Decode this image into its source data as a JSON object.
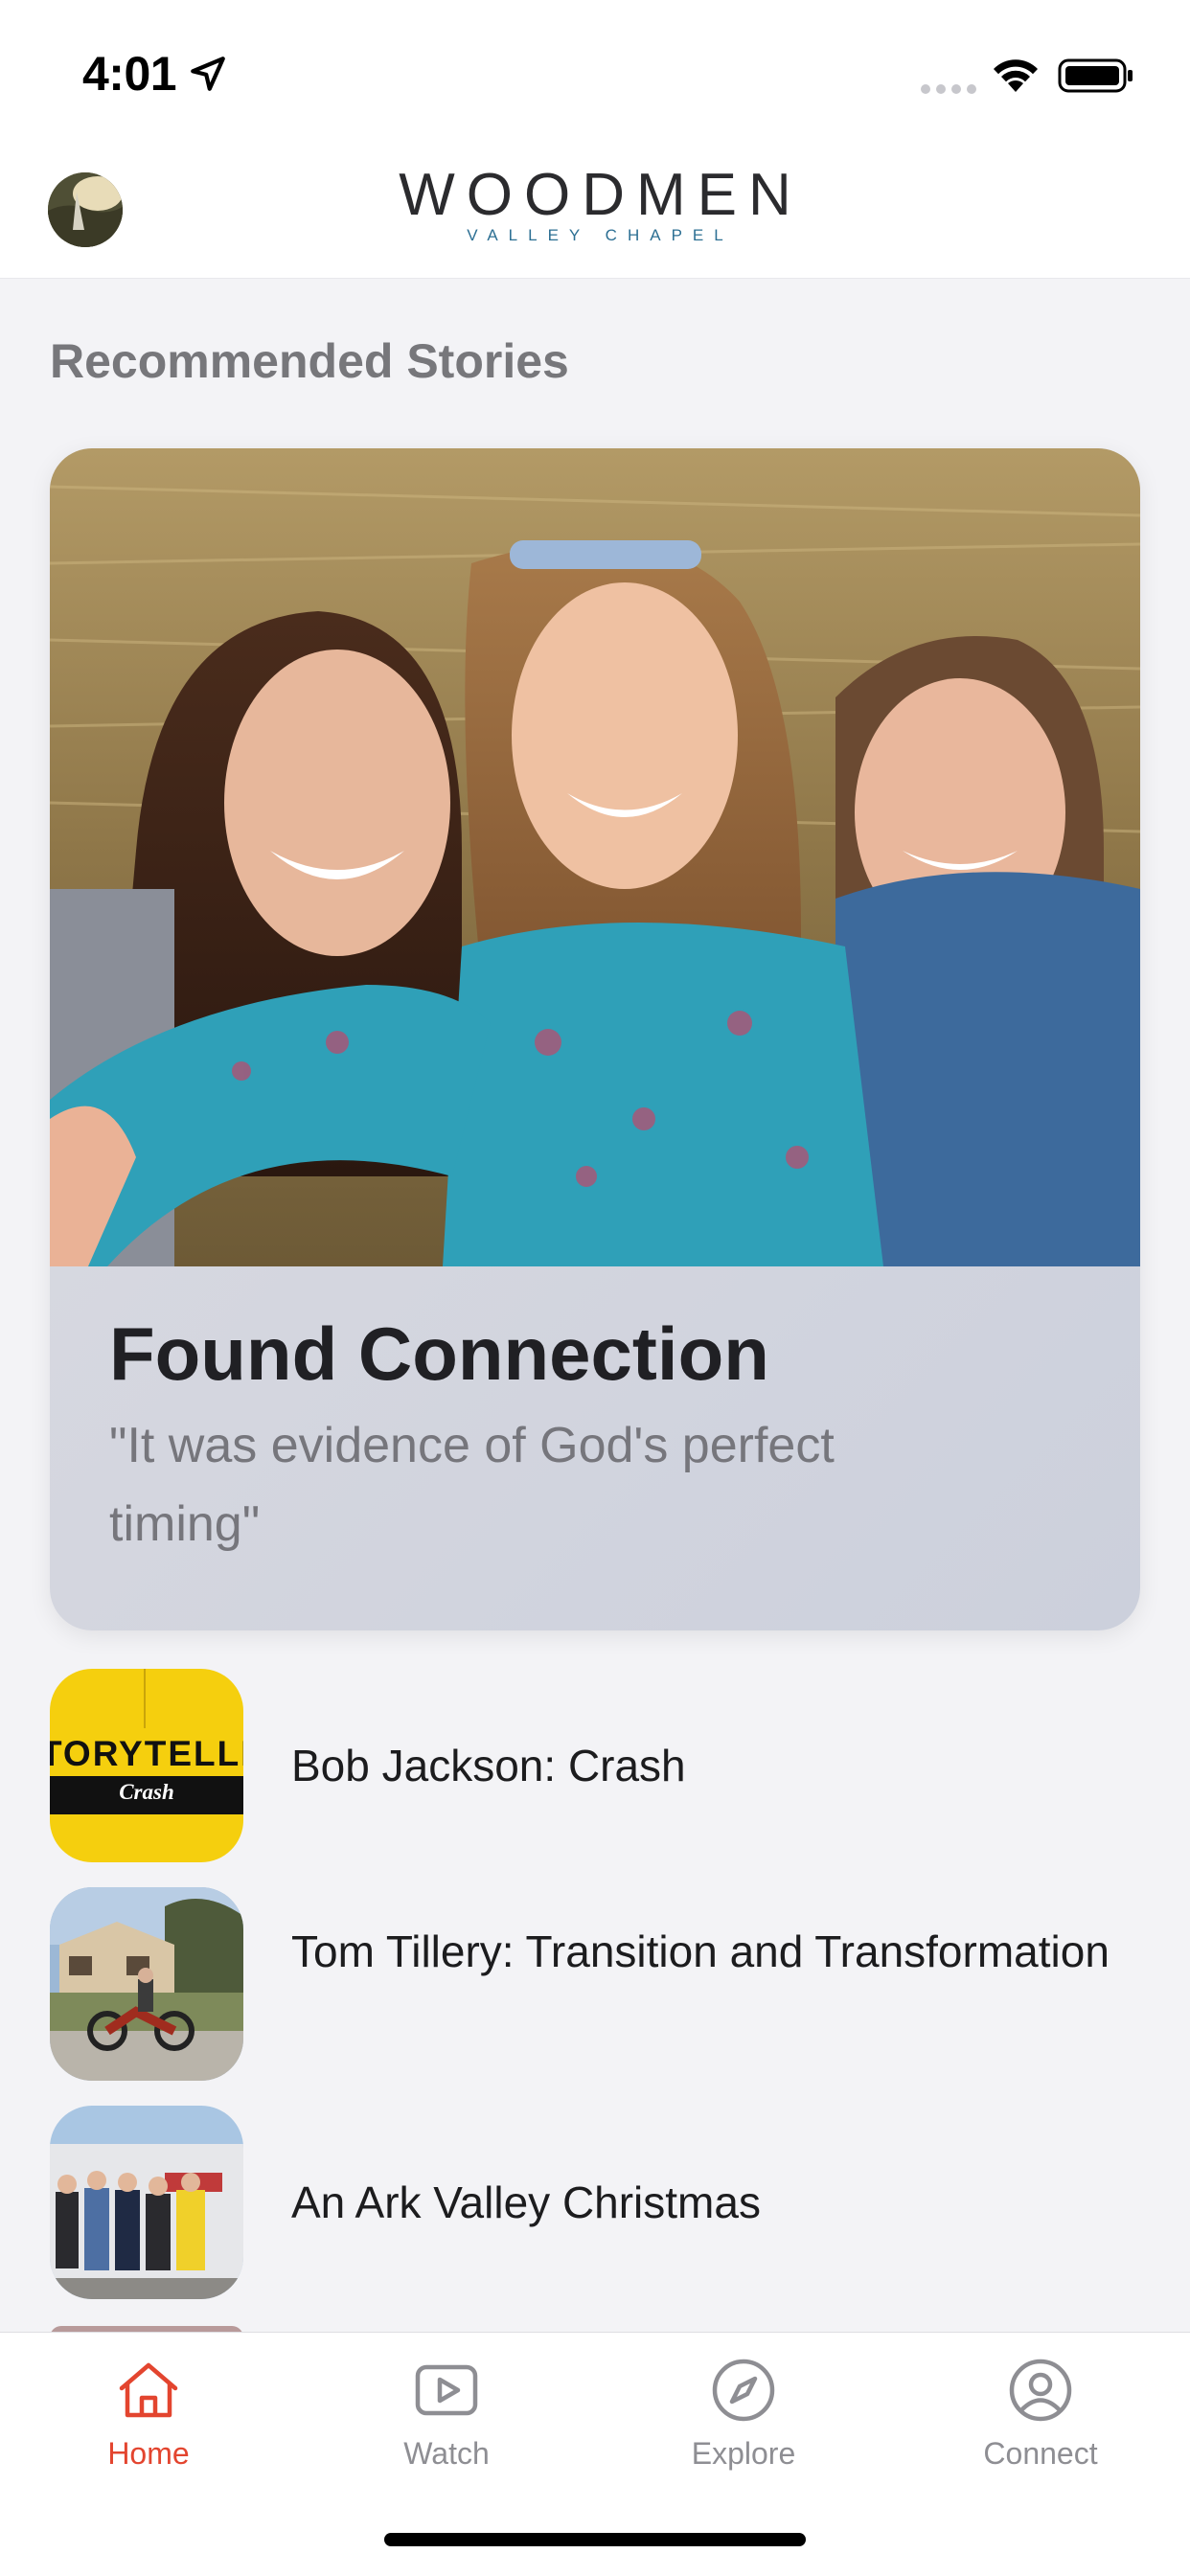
{
  "status_bar": {
    "time": "4:01",
    "icons": [
      "location-arrow-icon",
      "cellular-signal-icon",
      "wifi-icon",
      "battery-icon"
    ]
  },
  "header": {
    "logo_main": "WOODMEN",
    "logo_sub": "VALLEY CHAPEL",
    "avatar_icon": "profile-avatar"
  },
  "section": {
    "title": "Recommended Stories"
  },
  "featured": {
    "title": "Found Connection",
    "subtitle": "\"It was evidence of God's perfect timing\""
  },
  "stories": [
    {
      "title": "Bob Jackson: Crash",
      "thumb_word": "TORYTELLERS",
      "thumb_sub": "Crash"
    },
    {
      "title": "Tom Tillery: Transition and Transformation"
    },
    {
      "title": "An Ark Valley Christmas"
    }
  ],
  "tabs": [
    {
      "label": "Home",
      "icon": "home-icon",
      "active": true
    },
    {
      "label": "Watch",
      "icon": "play-icon",
      "active": false
    },
    {
      "label": "Explore",
      "icon": "compass-icon",
      "active": false
    },
    {
      "label": "Connect",
      "icon": "user-circle-icon",
      "active": false
    }
  ],
  "colors": {
    "accent": "#e3452f",
    "inactive": "#8e8e93",
    "logo_sub": "#2c6f93",
    "section_title": "#77777b",
    "storytellers_yellow": "#f5cf0e"
  }
}
